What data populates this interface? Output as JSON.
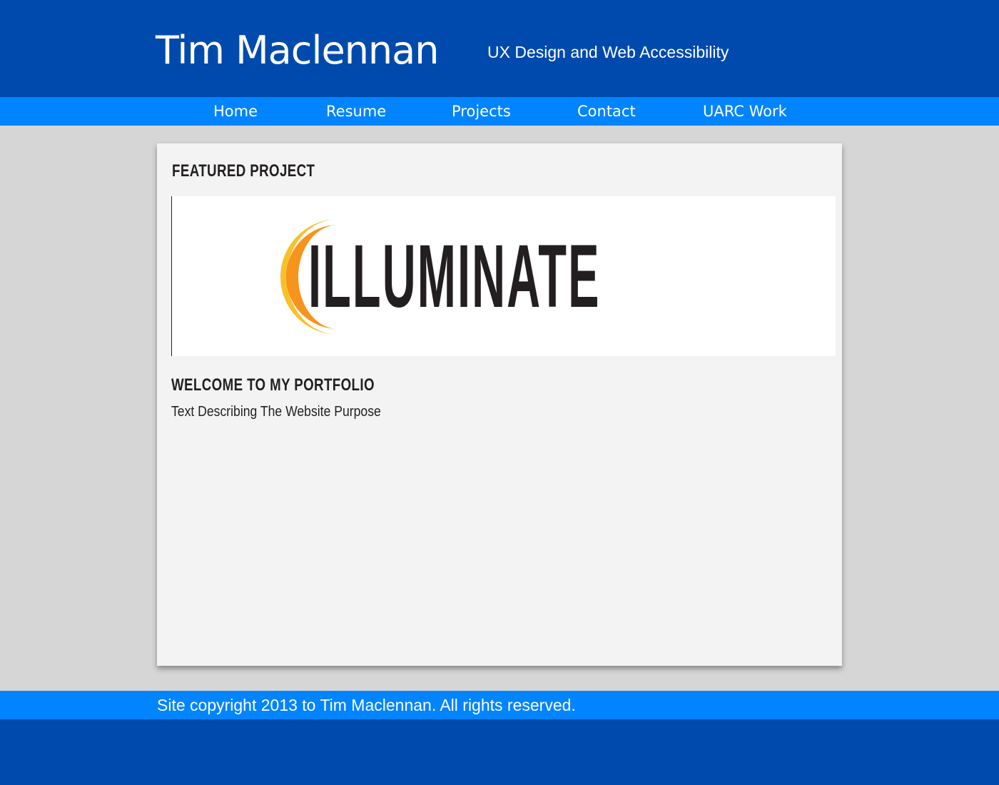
{
  "header": {
    "site_title": "Tim Maclennan",
    "tagline": "UX Design and Web Accessibility"
  },
  "nav": {
    "items": [
      {
        "label": "Home"
      },
      {
        "label": "Resume"
      },
      {
        "label": "Projects"
      },
      {
        "label": "Contact"
      },
      {
        "label": "UARC Work"
      }
    ]
  },
  "main": {
    "featured_heading": "Featured Project",
    "featured_project": {
      "logo_text": "ILLUMINATE",
      "logo_icon": "crescent-moon-icon"
    },
    "welcome_heading": "Welcome to my portfolio",
    "purpose_text": "Text Describing The Website Purpose"
  },
  "footer": {
    "copyright": "Site copyright 2013 to Tim Maclennan. All rights reserved."
  },
  "colors": {
    "header_blue": "#004aad",
    "nav_blue": "#0084ff",
    "page_background": "#d6d6d6",
    "card_background": "#f3f3f3",
    "logo_orange": "#f7941d",
    "logo_yellow": "#f7c12a",
    "text_dark": "#231f20"
  }
}
